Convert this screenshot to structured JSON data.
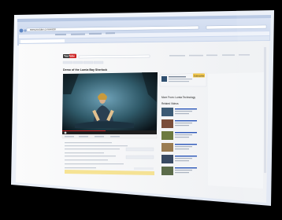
{
  "browser": {
    "url_text": "www.youtube.com/watch"
  },
  "youtube": {
    "logo_text": "YouTube",
    "video_title": "Demo of the Lumia Bay Sherlock",
    "sidebar_heading": "More From: Lumia Technology",
    "sidebar_subheading": "Related Videos",
    "sidebar_button": "Subscribe"
  },
  "colors": {
    "background": "#000000",
    "window_frame": "#e9eef8",
    "page_bg": "#ffffff",
    "player_bg": "#0d1a22",
    "youtube_red": "#cc1f1f",
    "accent_yellow": "#f1c64a"
  }
}
